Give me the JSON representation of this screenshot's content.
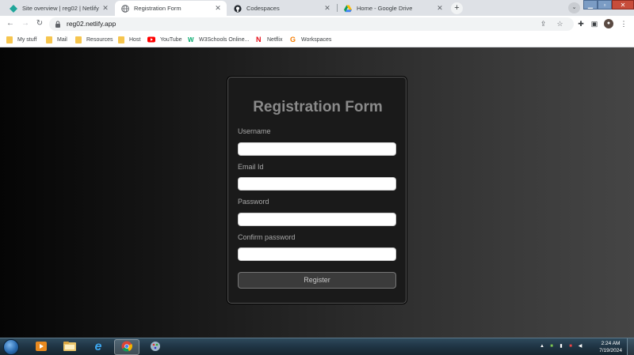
{
  "browser": {
    "tabs": [
      {
        "title": "Site overview | reg02 | Netlify",
        "icon": "netlify-icon",
        "active": false
      },
      {
        "title": "Registration Form",
        "icon": "globe-icon",
        "active": true
      },
      {
        "title": "Codespaces",
        "icon": "github-icon",
        "active": false
      },
      {
        "title": "Home - Google Drive",
        "icon": "google-drive-icon",
        "active": false
      }
    ],
    "new_tab_label": "+",
    "url": "reg02.netlify.app",
    "bookmarks": [
      {
        "label": "My stuff",
        "icon": "folder-icon"
      },
      {
        "label": "Mail",
        "icon": "folder-icon"
      },
      {
        "label": "Resources",
        "icon": "folder-icon"
      },
      {
        "label": "Host",
        "icon": "folder-icon"
      },
      {
        "label": "YouTube",
        "icon": "youtube-icon"
      },
      {
        "label": "W3Schools Online...",
        "icon": "w3schools-icon"
      },
      {
        "label": "Netflix",
        "icon": "netflix-icon"
      },
      {
        "label": "Workspaces",
        "icon": "workspaces-icon"
      }
    ]
  },
  "form": {
    "title": "Registration Form",
    "fields": [
      {
        "label": "Username",
        "value": ""
      },
      {
        "label": "Email Id",
        "value": ""
      },
      {
        "label": "Password",
        "value": ""
      },
      {
        "label": "Confirm password",
        "value": ""
      }
    ],
    "submit_label": "Register"
  },
  "taskbar": {
    "time": "2:24 AM",
    "date": "7/19/2024"
  },
  "colors": {
    "page_bg_dark": "#050505",
    "page_bg_light": "#454545",
    "card_bg": "#1a1a1a",
    "title_color": "#8a8a8a",
    "button_bg": "#3b3b3b"
  }
}
